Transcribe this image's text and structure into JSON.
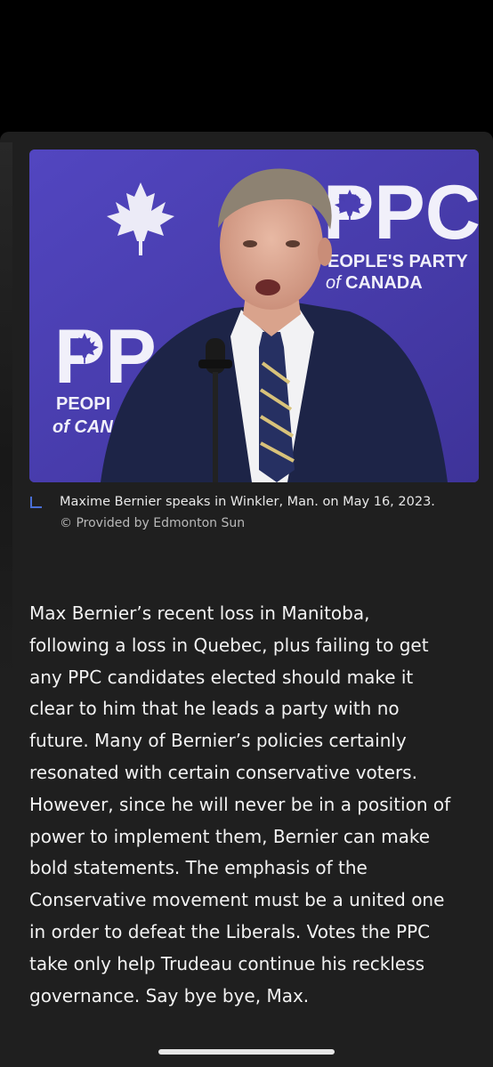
{
  "photo": {
    "background_color": "#4b3fb3",
    "logo_right_letters": "PPC",
    "logo_right_line1": "EOPLE'S PARTY",
    "logo_right_line2": "CANADA",
    "logo_right_of": "of",
    "logo_left_letters": "PP",
    "logo_left_line1": "PEOPI",
    "logo_left_line2": "of CAN"
  },
  "caption": {
    "text": "Maxime Bernier speaks in Winkler, Man. on May 16, 2023.",
    "credit": "© Provided by Edmonton Sun"
  },
  "body": {
    "lines": [
      "Max Bernier’s recent loss in Manitoba,",
      "following a loss in Quebec, plus failing to get",
      "any PPC candidates elected should make it",
      "clear to him that he leads a party with no",
      "future. Many of Bernier’s policies certainly",
      "resonated with certain conservative voters.",
      "However, since he will never be in a position of",
      "power to implement them, Bernier can make",
      "bold statements. The emphasis of the",
      "Conservative movement must be a united one",
      "in order to defeat the Liberals. Votes the PPC",
      "take only help Trudeau continue his reckless",
      "governance. Say bye bye, Max."
    ]
  }
}
